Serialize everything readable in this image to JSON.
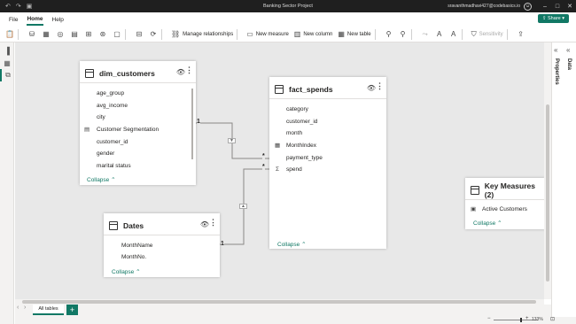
{
  "window": {
    "title": "Banking Sector Project",
    "user": "sravanthmadhavi427@codebasics.io"
  },
  "menu": {
    "items": [
      "File",
      "Home",
      "Help"
    ],
    "share_label": "Share"
  },
  "ribbon": {
    "manage_relationships": "Manage relationships",
    "new_measure": "New measure",
    "new_column": "New column",
    "new_table": "New table",
    "sensitivity": "Sensitivity"
  },
  "right_panel": {
    "data": "Data",
    "properties": "Properties"
  },
  "tables": {
    "dim_customers": {
      "name": "dim_customers",
      "fields": [
        "age_group",
        "avg_income",
        "city",
        "Customer Segmentation",
        "customer_id",
        "gender",
        "marital status"
      ],
      "collapse": "Collapse"
    },
    "fact_spends": {
      "name": "fact_spends",
      "fields": [
        "category",
        "customer_id",
        "month",
        "MonthIndex",
        "payment_type",
        "spend"
      ],
      "collapse": "Collapse"
    },
    "dates": {
      "name": "Dates",
      "fields": [
        "MonthName",
        "MonthNo."
      ],
      "collapse": "Collapse"
    },
    "key_measures": {
      "name": "Key Measures (2)",
      "fields": [
        "Active Customers"
      ],
      "collapse": "Collapse"
    }
  },
  "relationships": {
    "one": "1",
    "many": "*"
  },
  "tabs": {
    "all_tables": "All tables",
    "add": "+"
  },
  "status": {
    "zoom": "133%"
  }
}
